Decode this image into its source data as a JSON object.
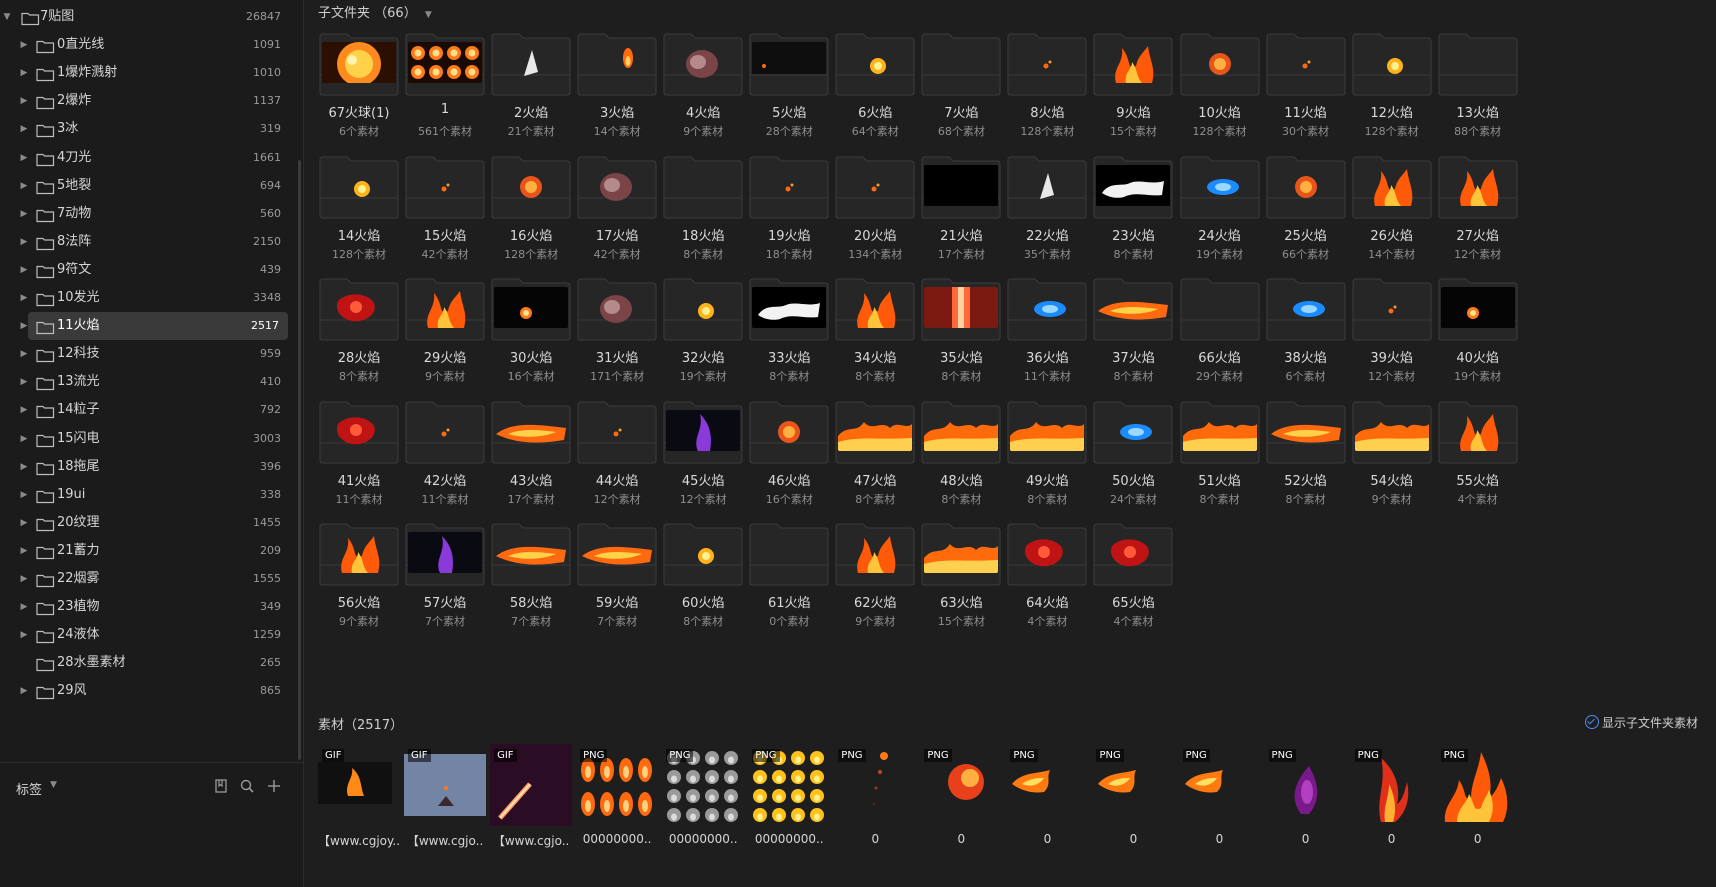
{
  "sidebar": {
    "root": {
      "label": "7贴图",
      "count": "26847"
    },
    "items": [
      {
        "label": "0直光线",
        "count": "1091"
      },
      {
        "label": "1爆炸溅射",
        "count": "1010"
      },
      {
        "label": "2爆炸",
        "count": "1137"
      },
      {
        "label": "3冰",
        "count": "319"
      },
      {
        "label": "4刀光",
        "count": "1661"
      },
      {
        "label": "5地裂",
        "count": "694"
      },
      {
        "label": "7动物",
        "count": "560"
      },
      {
        "label": "8法阵",
        "count": "2150"
      },
      {
        "label": "9符文",
        "count": "439"
      },
      {
        "label": "10发光",
        "count": "3348"
      },
      {
        "label": "11火焰",
        "count": "2517",
        "active": true
      },
      {
        "label": "12科技",
        "count": "959"
      },
      {
        "label": "13流光",
        "count": "410"
      },
      {
        "label": "14粒子",
        "count": "792"
      },
      {
        "label": "15闪电",
        "count": "3003"
      },
      {
        "label": "18拖尾",
        "count": "396"
      },
      {
        "label": "19ui",
        "count": "338"
      },
      {
        "label": "20纹理",
        "count": "1455"
      },
      {
        "label": "21蓄力",
        "count": "209"
      },
      {
        "label": "22烟雾",
        "count": "1555"
      },
      {
        "label": "23植物",
        "count": "349"
      },
      {
        "label": "24液体",
        "count": "1259"
      },
      {
        "label": "28水墨素材",
        "count": "265",
        "no_arrow": true
      },
      {
        "label": "29风",
        "count": "865"
      }
    ],
    "tags_label": "标签",
    "tag_icons": [
      "bookmark-icon",
      "search-icon",
      "plus-icon"
    ]
  },
  "subfolders": {
    "title": "子文件夹",
    "count": "（66）",
    "items": [
      {
        "name": "67火球(1)",
        "sub": "6个素材",
        "thumb": "fireball"
      },
      {
        "name": "1",
        "sub": "561个素材",
        "thumb": "orbs"
      },
      {
        "name": "2火焰",
        "sub": "21个素材",
        "thumb": "white"
      },
      {
        "name": "3火焰",
        "sub": "14个素材",
        "thumb": "small"
      },
      {
        "name": "4火焰",
        "sub": "9个素材",
        "thumb": "smoke"
      },
      {
        "name": "5火焰",
        "sub": "28个素材",
        "thumb": "dark"
      },
      {
        "name": "6火焰",
        "sub": "64个素材",
        "thumb": "yellow"
      },
      {
        "name": "7火焰",
        "sub": "68个素材",
        "thumb": "empty"
      },
      {
        "name": "8火焰",
        "sub": "128个素材",
        "thumb": "spark"
      },
      {
        "name": "9火焰",
        "sub": "15个素材",
        "thumb": "flames"
      },
      {
        "name": "10火焰",
        "sub": "128个素材",
        "thumb": "orange"
      },
      {
        "name": "11火焰",
        "sub": "30个素材",
        "thumb": "spark"
      },
      {
        "name": "12火焰",
        "sub": "128个素材",
        "thumb": "yellow"
      },
      {
        "name": "13火焰",
        "sub": "88个素材",
        "thumb": "empty"
      },
      {
        "name": "14火焰",
        "sub": "128个素材",
        "thumb": "yellow"
      },
      {
        "name": "15火焰",
        "sub": "42个素材",
        "thumb": "spark"
      },
      {
        "name": "16火焰",
        "sub": "128个素材",
        "thumb": "orange"
      },
      {
        "name": "17火焰",
        "sub": "42个素材",
        "thumb": "smoke"
      },
      {
        "name": "18火焰",
        "sub": "8个素材",
        "thumb": "empty"
      },
      {
        "name": "19火焰",
        "sub": "18个素材",
        "thumb": "spark"
      },
      {
        "name": "20火焰",
        "sub": "134个素材",
        "thumb": "spark"
      },
      {
        "name": "21火焰",
        "sub": "17个素材",
        "thumb": "black"
      },
      {
        "name": "22火焰",
        "sub": "35个素材",
        "thumb": "white"
      },
      {
        "name": "23火焰",
        "sub": "8个素材",
        "thumb": "whitesplash"
      },
      {
        "name": "24火焰",
        "sub": "19个素材",
        "thumb": "blue"
      },
      {
        "name": "25火焰",
        "sub": "66个素材",
        "thumb": "orange"
      },
      {
        "name": "26火焰",
        "sub": "14个素材",
        "thumb": "flames"
      },
      {
        "name": "27火焰",
        "sub": "12个素材",
        "thumb": "flames"
      },
      {
        "name": "28火焰",
        "sub": "8个素材",
        "thumb": "red"
      },
      {
        "name": "29火焰",
        "sub": "9个素材",
        "thumb": "flames"
      },
      {
        "name": "30火焰",
        "sub": "16个素材",
        "thumb": "darkglow"
      },
      {
        "name": "31火焰",
        "sub": "171个素材",
        "thumb": "smoke"
      },
      {
        "name": "32火焰",
        "sub": "19个素材",
        "thumb": "yellow"
      },
      {
        "name": "33火焰",
        "sub": "8个素材",
        "thumb": "whitesplash"
      },
      {
        "name": "34火焰",
        "sub": "8个素材",
        "thumb": "flames"
      },
      {
        "name": "35火焰",
        "sub": "8个素材",
        "thumb": "pillar"
      },
      {
        "name": "36火焰",
        "sub": "11个素材",
        "thumb": "blue"
      },
      {
        "name": "37火焰",
        "sub": "8个素材",
        "thumb": "streak"
      },
      {
        "name": "66火焰",
        "sub": "29个素材",
        "thumb": "empty"
      },
      {
        "name": "38火焰",
        "sub": "6个素材",
        "thumb": "blue"
      },
      {
        "name": "39火焰",
        "sub": "12个素材",
        "thumb": "spark"
      },
      {
        "name": "40火焰",
        "sub": "19个素材",
        "thumb": "darkglow"
      },
      {
        "name": "41火焰",
        "sub": "11个素材",
        "thumb": "red"
      },
      {
        "name": "42火焰",
        "sub": "11个素材",
        "thumb": "spark"
      },
      {
        "name": "43火焰",
        "sub": "17个素材",
        "thumb": "streak"
      },
      {
        "name": "44火焰",
        "sub": "12个素材",
        "thumb": "spark"
      },
      {
        "name": "45火焰",
        "sub": "12个素材",
        "thumb": "purple"
      },
      {
        "name": "46火焰",
        "sub": "16个素材",
        "thumb": "orange"
      },
      {
        "name": "47火焰",
        "sub": "8个素材",
        "thumb": "wall"
      },
      {
        "name": "48火焰",
        "sub": "8个素材",
        "thumb": "wall"
      },
      {
        "name": "49火焰",
        "sub": "8个素材",
        "thumb": "wall"
      },
      {
        "name": "50火焰",
        "sub": "24个素材",
        "thumb": "blue"
      },
      {
        "name": "51火焰",
        "sub": "8个素材",
        "thumb": "wall"
      },
      {
        "name": "52火焰",
        "sub": "8个素材",
        "thumb": "streak"
      },
      {
        "name": "54火焰",
        "sub": "9个素材",
        "thumb": "wall"
      },
      {
        "name": "55火焰",
        "sub": "4个素材",
        "thumb": "flames"
      },
      {
        "name": "56火焰",
        "sub": "9个素材",
        "thumb": "flames"
      },
      {
        "name": "57火焰",
        "sub": "7个素材",
        "thumb": "purple"
      },
      {
        "name": "58火焰",
        "sub": "7个素材",
        "thumb": "streak"
      },
      {
        "name": "59火焰",
        "sub": "7个素材",
        "thumb": "streak"
      },
      {
        "name": "60火焰",
        "sub": "8个素材",
        "thumb": "yellow"
      },
      {
        "name": "61火焰",
        "sub": "0个素材",
        "thumb": "empty"
      },
      {
        "name": "62火焰",
        "sub": "9个素材",
        "thumb": "flames"
      },
      {
        "name": "63火焰",
        "sub": "15个素材",
        "thumb": "wall"
      },
      {
        "name": "64火焰",
        "sub": "4个素材",
        "thumb": "red"
      },
      {
        "name": "65火焰",
        "sub": "4个素材",
        "thumb": "red"
      }
    ]
  },
  "materials": {
    "title": "素材（2517）",
    "show_sub_label": "显示子文件夹素材",
    "items": [
      {
        "badge": "GIF",
        "name": "【www.cgjoy..",
        "thumb": "gif1"
      },
      {
        "badge": "GIF",
        "name": "【www.cgjo..",
        "thumb": "gif2"
      },
      {
        "badge": "GIF",
        "name": "【www.cgjo..",
        "thumb": "gif3"
      },
      {
        "badge": "PNG",
        "name": "00000000..",
        "thumb": "sheetfire"
      },
      {
        "badge": "PNG",
        "name": "00000000..",
        "thumb": "sheetsmoke"
      },
      {
        "badge": "PNG",
        "name": "00000000..",
        "thumb": "sheetyellow"
      },
      {
        "badge": "PNG",
        "name": "0",
        "thumb": "trail"
      },
      {
        "badge": "PNG",
        "name": "0",
        "thumb": "ball"
      },
      {
        "badge": "PNG",
        "name": "0",
        "thumb": "flare"
      },
      {
        "badge": "PNG",
        "name": "0",
        "thumb": "flare"
      },
      {
        "badge": "PNG",
        "name": "0",
        "thumb": "flare"
      },
      {
        "badge": "PNG",
        "name": "0",
        "thumb": "purple"
      },
      {
        "badge": "PNG",
        "name": "0",
        "thumb": "tall"
      },
      {
        "badge": "PNG",
        "name": "0",
        "thumb": "bonfire"
      }
    ]
  },
  "colors": {
    "accent": "#4a8df0",
    "active_row": "#3a3a3a",
    "fire": "#ff7a1a"
  }
}
